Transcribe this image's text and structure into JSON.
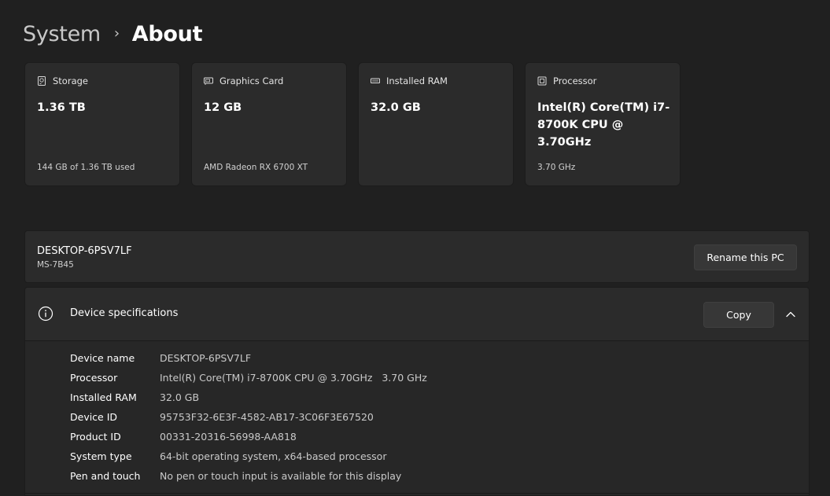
{
  "breadcrumb": {
    "parent": "System",
    "separator": "›",
    "current": "About"
  },
  "cards": [
    {
      "icon": "storage-icon",
      "label": "Storage",
      "value": "1.36 TB",
      "sub": "144 GB of 1.36 TB used"
    },
    {
      "icon": "graphics-card-icon",
      "label": "Graphics Card",
      "value": "12 GB",
      "sub": "AMD Radeon RX 6700 XT"
    },
    {
      "icon": "ram-icon",
      "label": "Installed RAM",
      "value": "32.0 GB",
      "sub": ""
    },
    {
      "icon": "processor-icon",
      "label": "Processor",
      "value": "Intel(R) Core(TM) i7-8700K CPU @ 3.70GHz",
      "sub": "3.70 GHz"
    }
  ],
  "pc": {
    "name": "DESKTOP-6PSV7LF",
    "model": "MS-7B45",
    "rename_label": "Rename this PC"
  },
  "specs": {
    "title": "Device specifications",
    "copy_label": "Copy",
    "rows": [
      {
        "key": "Device name",
        "value": "DESKTOP-6PSV7LF"
      },
      {
        "key": "Processor",
        "value": "Intel(R) Core(TM) i7-8700K CPU @ 3.70GHz   3.70 GHz"
      },
      {
        "key": "Installed RAM",
        "value": "32.0 GB"
      },
      {
        "key": "Device ID",
        "value": "95753F32-6E3F-4582-AB17-3C06F3E67520"
      },
      {
        "key": "Product ID",
        "value": "00331-20316-56998-AA818"
      },
      {
        "key": "System type",
        "value": "64-bit operating system, x64-based processor"
      },
      {
        "key": "Pen and touch",
        "value": "No pen or touch input is available for this display"
      }
    ]
  },
  "colors": {
    "background": "#202020",
    "card": "#2b2b2b",
    "button": "#373737"
  }
}
